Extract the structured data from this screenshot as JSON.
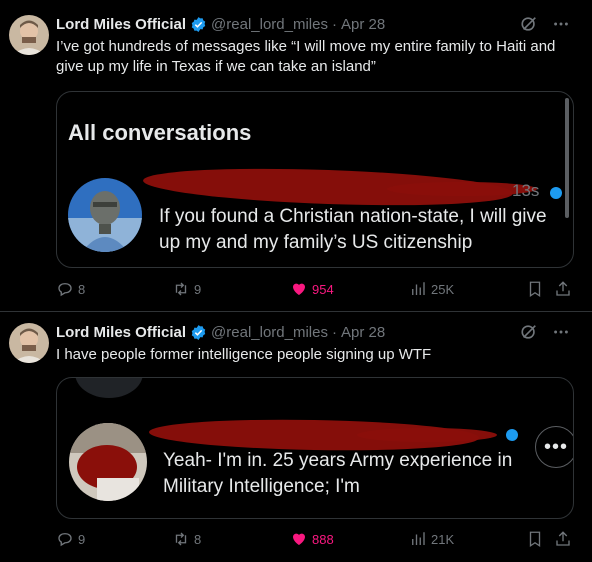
{
  "colors": {
    "accent": "#1d9bf0",
    "like": "#f91880",
    "muted": "#71767b",
    "redaction": "#8a0f0a"
  },
  "tweets": [
    {
      "author_name": "Lord Miles Official",
      "handle": "@real_lord_miles",
      "separator": "·",
      "date": "Apr 28",
      "text": "I’ve got hundreds of messages like “I will move my entire family to Haiti and give up my life in Texas if we can take an island”",
      "media": {
        "title": "All conversations",
        "time": "13s",
        "message": "If you found a Christian nation-state, I will give up my and my family’s US citizenship"
      },
      "stats": {
        "replies": "8",
        "reposts": "9",
        "likes": "954",
        "views": "25K"
      }
    },
    {
      "author_name": "Lord Miles Official",
      "handle": "@real_lord_miles",
      "separator": "·",
      "date": "Apr 28",
      "text": "I have people former intelligence people signing up WTF",
      "media": {
        "message": "Yeah- I'm in. 25 years Army experience in Military Intelligence; I'm",
        "more": "•••"
      },
      "stats": {
        "replies": "9",
        "reposts": "8",
        "likes": "888",
        "views": "21K"
      }
    }
  ],
  "icons": [
    "verified-badge-icon",
    "grok-icon",
    "more-icon",
    "reply-icon",
    "repost-icon",
    "heart-icon",
    "views-icon",
    "bookmark-icon",
    "share-icon"
  ]
}
